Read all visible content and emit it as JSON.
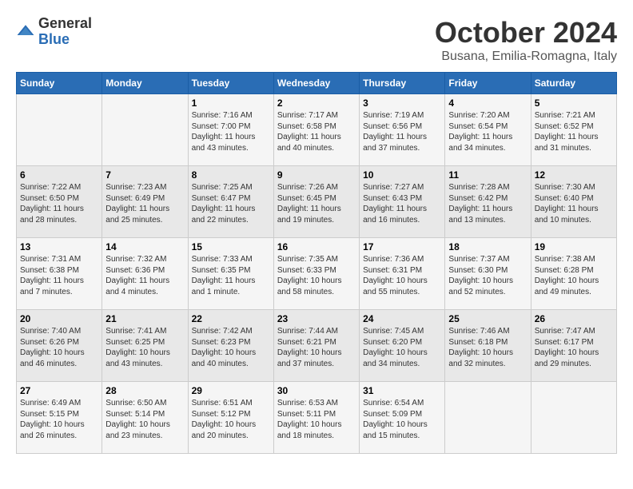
{
  "logo": {
    "general": "General",
    "blue": "Blue"
  },
  "title": "October 2024",
  "location": "Busana, Emilia-Romagna, Italy",
  "days_of_week": [
    "Sunday",
    "Monday",
    "Tuesday",
    "Wednesday",
    "Thursday",
    "Friday",
    "Saturday"
  ],
  "weeks": [
    [
      {
        "day": "",
        "info": ""
      },
      {
        "day": "",
        "info": ""
      },
      {
        "day": "1",
        "info": "Sunrise: 7:16 AM\nSunset: 7:00 PM\nDaylight: 11 hours and 43 minutes."
      },
      {
        "day": "2",
        "info": "Sunrise: 7:17 AM\nSunset: 6:58 PM\nDaylight: 11 hours and 40 minutes."
      },
      {
        "day": "3",
        "info": "Sunrise: 7:19 AM\nSunset: 6:56 PM\nDaylight: 11 hours and 37 minutes."
      },
      {
        "day": "4",
        "info": "Sunrise: 7:20 AM\nSunset: 6:54 PM\nDaylight: 11 hours and 34 minutes."
      },
      {
        "day": "5",
        "info": "Sunrise: 7:21 AM\nSunset: 6:52 PM\nDaylight: 11 hours and 31 minutes."
      }
    ],
    [
      {
        "day": "6",
        "info": "Sunrise: 7:22 AM\nSunset: 6:50 PM\nDaylight: 11 hours and 28 minutes."
      },
      {
        "day": "7",
        "info": "Sunrise: 7:23 AM\nSunset: 6:49 PM\nDaylight: 11 hours and 25 minutes."
      },
      {
        "day": "8",
        "info": "Sunrise: 7:25 AM\nSunset: 6:47 PM\nDaylight: 11 hours and 22 minutes."
      },
      {
        "day": "9",
        "info": "Sunrise: 7:26 AM\nSunset: 6:45 PM\nDaylight: 11 hours and 19 minutes."
      },
      {
        "day": "10",
        "info": "Sunrise: 7:27 AM\nSunset: 6:43 PM\nDaylight: 11 hours and 16 minutes."
      },
      {
        "day": "11",
        "info": "Sunrise: 7:28 AM\nSunset: 6:42 PM\nDaylight: 11 hours and 13 minutes."
      },
      {
        "day": "12",
        "info": "Sunrise: 7:30 AM\nSunset: 6:40 PM\nDaylight: 11 hours and 10 minutes."
      }
    ],
    [
      {
        "day": "13",
        "info": "Sunrise: 7:31 AM\nSunset: 6:38 PM\nDaylight: 11 hours and 7 minutes."
      },
      {
        "day": "14",
        "info": "Sunrise: 7:32 AM\nSunset: 6:36 PM\nDaylight: 11 hours and 4 minutes."
      },
      {
        "day": "15",
        "info": "Sunrise: 7:33 AM\nSunset: 6:35 PM\nDaylight: 11 hours and 1 minute."
      },
      {
        "day": "16",
        "info": "Sunrise: 7:35 AM\nSunset: 6:33 PM\nDaylight: 10 hours and 58 minutes."
      },
      {
        "day": "17",
        "info": "Sunrise: 7:36 AM\nSunset: 6:31 PM\nDaylight: 10 hours and 55 minutes."
      },
      {
        "day": "18",
        "info": "Sunrise: 7:37 AM\nSunset: 6:30 PM\nDaylight: 10 hours and 52 minutes."
      },
      {
        "day": "19",
        "info": "Sunrise: 7:38 AM\nSunset: 6:28 PM\nDaylight: 10 hours and 49 minutes."
      }
    ],
    [
      {
        "day": "20",
        "info": "Sunrise: 7:40 AM\nSunset: 6:26 PM\nDaylight: 10 hours and 46 minutes."
      },
      {
        "day": "21",
        "info": "Sunrise: 7:41 AM\nSunset: 6:25 PM\nDaylight: 10 hours and 43 minutes."
      },
      {
        "day": "22",
        "info": "Sunrise: 7:42 AM\nSunset: 6:23 PM\nDaylight: 10 hours and 40 minutes."
      },
      {
        "day": "23",
        "info": "Sunrise: 7:44 AM\nSunset: 6:21 PM\nDaylight: 10 hours and 37 minutes."
      },
      {
        "day": "24",
        "info": "Sunrise: 7:45 AM\nSunset: 6:20 PM\nDaylight: 10 hours and 34 minutes."
      },
      {
        "day": "25",
        "info": "Sunrise: 7:46 AM\nSunset: 6:18 PM\nDaylight: 10 hours and 32 minutes."
      },
      {
        "day": "26",
        "info": "Sunrise: 7:47 AM\nSunset: 6:17 PM\nDaylight: 10 hours and 29 minutes."
      }
    ],
    [
      {
        "day": "27",
        "info": "Sunrise: 6:49 AM\nSunset: 5:15 PM\nDaylight: 10 hours and 26 minutes."
      },
      {
        "day": "28",
        "info": "Sunrise: 6:50 AM\nSunset: 5:14 PM\nDaylight: 10 hours and 23 minutes."
      },
      {
        "day": "29",
        "info": "Sunrise: 6:51 AM\nSunset: 5:12 PM\nDaylight: 10 hours and 20 minutes."
      },
      {
        "day": "30",
        "info": "Sunrise: 6:53 AM\nSunset: 5:11 PM\nDaylight: 10 hours and 18 minutes."
      },
      {
        "day": "31",
        "info": "Sunrise: 6:54 AM\nSunset: 5:09 PM\nDaylight: 10 hours and 15 minutes."
      },
      {
        "day": "",
        "info": ""
      },
      {
        "day": "",
        "info": ""
      }
    ]
  ]
}
